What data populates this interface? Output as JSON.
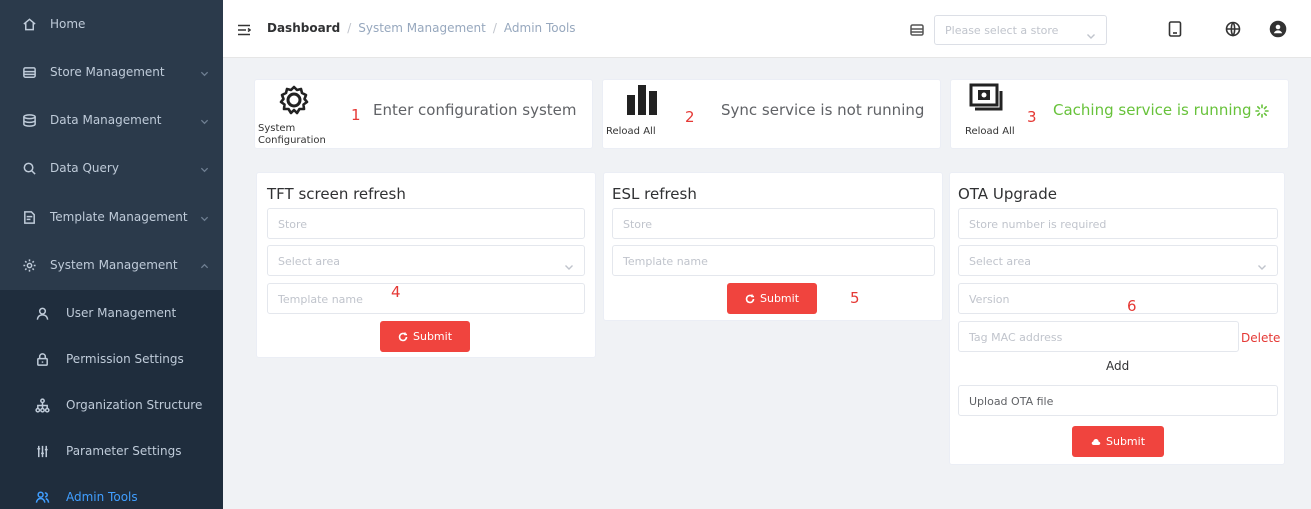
{
  "sidebar": {
    "items": [
      {
        "label": "Home"
      },
      {
        "label": "Store Management"
      },
      {
        "label": "Data Management"
      },
      {
        "label": "Data Query"
      },
      {
        "label": "Template Management"
      },
      {
        "label": "System Management"
      }
    ],
    "subitems": [
      {
        "label": "User Management"
      },
      {
        "label": "Permission Settings"
      },
      {
        "label": "Organization Structure"
      },
      {
        "label": "Parameter Settings"
      },
      {
        "label": "Admin Tools"
      }
    ],
    "active_color": "#409eff",
    "bg_color": "#2b3a4b"
  },
  "header": {
    "breadcrumb": [
      "Dashboard",
      "System Management",
      "Admin Tools"
    ],
    "separator": "/",
    "store_select": {
      "placeholder": "Please select a store"
    }
  },
  "topcards": [
    {
      "icon": "gear-icon",
      "label": "System Configuration",
      "num": "1",
      "text": "Enter configuration system"
    },
    {
      "icon": "bar-chart-icon",
      "label": "Reload All",
      "num": "2",
      "text": "Sync service is not running"
    },
    {
      "icon": "cache-icon",
      "label": "Reload All",
      "num": "3",
      "text": "Caching service is running",
      "text_color": "#67c23a"
    }
  ],
  "tft": {
    "title": "TFT screen refresh",
    "store_ph": "Store",
    "area_ph": "Select area",
    "template_ph": "Template name",
    "num": "4",
    "submit": "Submit"
  },
  "esl": {
    "title": "ESL refresh",
    "store_ph": "Store",
    "template_ph": "Template name",
    "num": "5",
    "submit": "Submit"
  },
  "ota": {
    "title": "OTA Upgrade",
    "store_ph": "Store number is required",
    "area_ph": "Select area",
    "version_ph": "Version",
    "num": "6",
    "mac_ph": "Tag MAC address",
    "delete": "Delete",
    "add": "Add",
    "upload": "Upload OTA file",
    "submit": "Submit"
  },
  "colors": {
    "accent_red": "#f0443e",
    "label_red": "#e53935",
    "running_green": "#67c23a"
  }
}
